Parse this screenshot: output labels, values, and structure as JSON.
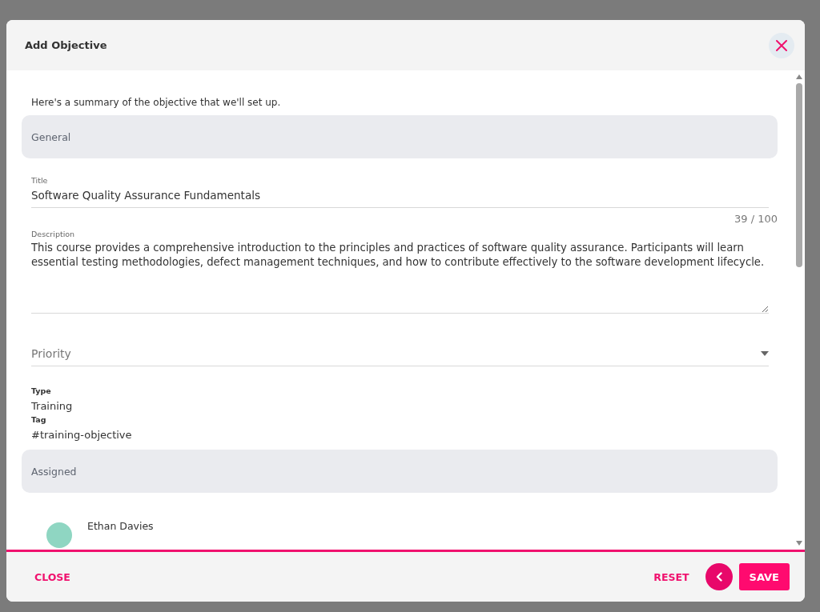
{
  "dialog": {
    "title": "Add Objective"
  },
  "intro": "Here's a summary of the objective that we'll set up.",
  "general": {
    "heading": "General"
  },
  "title_field": {
    "label": "Title",
    "value": "Software Quality Assurance Fundamentals",
    "counter": "39 / 100"
  },
  "description_field": {
    "label": "Description",
    "value": "This course provides a comprehensive introduction to the principles and practices of software quality assurance. Participants will learn essential testing methodologies, defect management techniques, and how to contribute effectively to the software development lifecycle."
  },
  "priority_field": {
    "placeholder": "Priority"
  },
  "type": {
    "label": "Type",
    "value": "Training"
  },
  "tag": {
    "label": "Tag",
    "value": "#training-objective"
  },
  "assigned": {
    "heading": "Assigned"
  },
  "assignees": [
    {
      "name": "Ethan Davies"
    }
  ],
  "footer": {
    "close": "CLOSE",
    "reset": "RESET",
    "save": "SAVE"
  }
}
